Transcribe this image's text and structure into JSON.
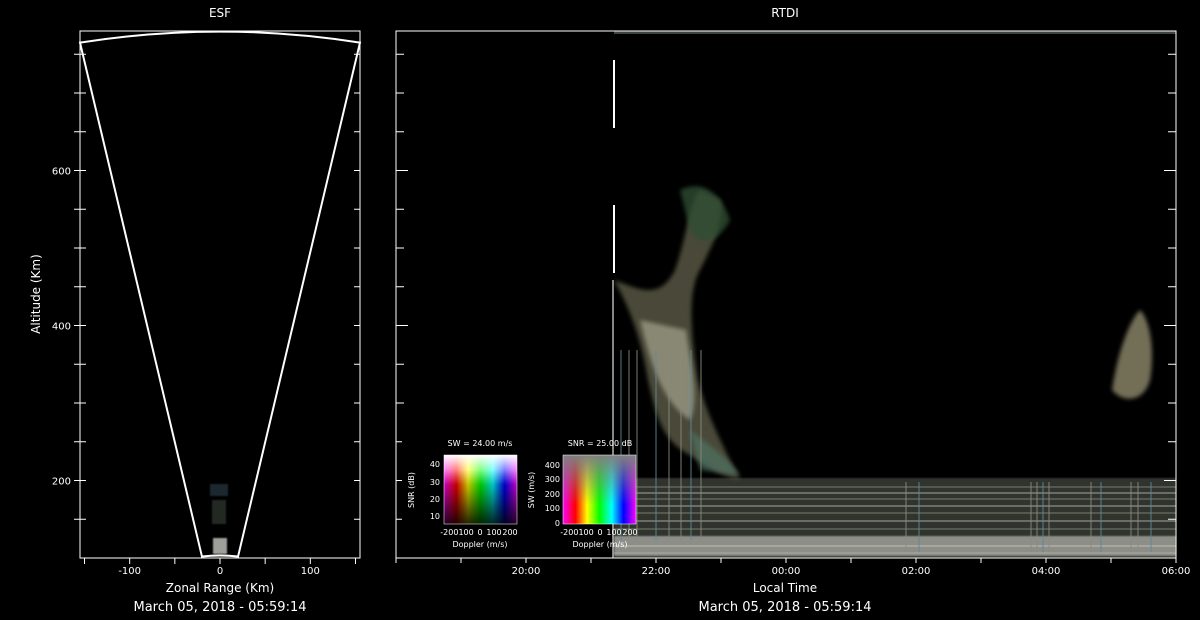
{
  "chart_data": [
    {
      "type": "heatmap",
      "title": "ESF",
      "xlabel": "Zonal Range (Km)",
      "ylabel": "Altitude (Km)",
      "footer": "March 05, 2018 - 05:59:14",
      "xlim": [
        -155,
        155
      ],
      "ylim": [
        100,
        780
      ],
      "xticks": [
        -100,
        0,
        100
      ],
      "yticks": [
        200,
        400,
        600
      ],
      "fan": {
        "left_edge": [
          [
            -155,
            765
          ],
          [
            -20,
            102
          ]
        ],
        "right_edge": [
          [
            155,
            765
          ],
          [
            20,
            102
          ]
        ],
        "top_arc_apex": 778
      }
    },
    {
      "type": "heatmap",
      "title": "RTDI",
      "xlabel": "Local Time",
      "footer": "March 05, 2018 - 05:59:14",
      "ylim": [
        100,
        780
      ],
      "xlim": [
        "18:00",
        "06:00"
      ],
      "xticks": [
        "20:00",
        "22:00",
        "00:00",
        "02:00",
        "04:00",
        "06:00"
      ],
      "yticks": [
        200,
        400,
        600
      ],
      "data_start": "21:40"
    }
  ],
  "legends": {
    "sw_legend": {
      "title": "SW = 24.00 m/s",
      "ylabel": "SNR (dB)",
      "xlabel": "Doppler (m/s)",
      "yticks": [
        "40",
        "30",
        "20",
        "10"
      ],
      "xticks": [
        "-200100",
        "0",
        "100",
        "200"
      ]
    },
    "snr_legend": {
      "title": "SNR = 25.00 dB",
      "ylabel": "SW (m/s)",
      "xlabel": "Doppler (m/s)",
      "yticks": [
        "400",
        "300",
        "200",
        "100",
        "0"
      ],
      "xticks": [
        "-200100",
        "0",
        "100",
        "200"
      ]
    }
  },
  "colors": {
    "background": "#000000",
    "axes": "#ffffff"
  }
}
